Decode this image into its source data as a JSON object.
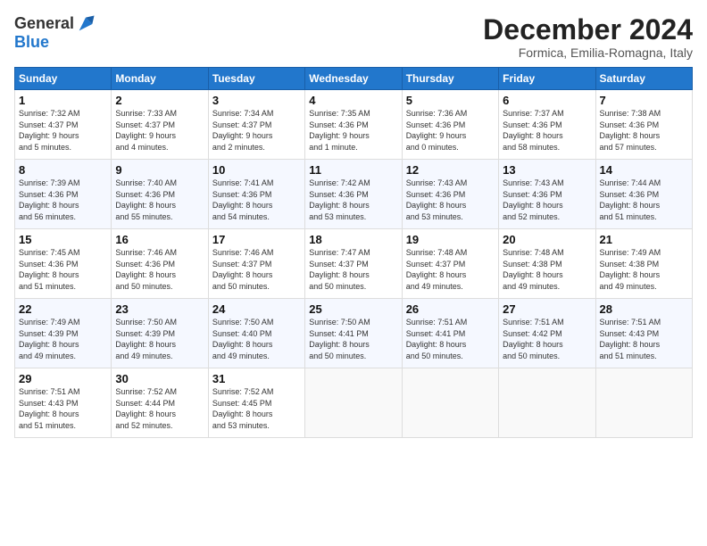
{
  "header": {
    "logo_line1": "General",
    "logo_line2": "Blue",
    "month": "December 2024",
    "location": "Formica, Emilia-Romagna, Italy"
  },
  "days_of_week": [
    "Sunday",
    "Monday",
    "Tuesday",
    "Wednesday",
    "Thursday",
    "Friday",
    "Saturday"
  ],
  "weeks": [
    [
      {
        "day": 1,
        "lines": [
          "Sunrise: 7:32 AM",
          "Sunset: 4:37 PM",
          "Daylight: 9 hours",
          "and 5 minutes."
        ]
      },
      {
        "day": 2,
        "lines": [
          "Sunrise: 7:33 AM",
          "Sunset: 4:37 PM",
          "Daylight: 9 hours",
          "and 4 minutes."
        ]
      },
      {
        "day": 3,
        "lines": [
          "Sunrise: 7:34 AM",
          "Sunset: 4:37 PM",
          "Daylight: 9 hours",
          "and 2 minutes."
        ]
      },
      {
        "day": 4,
        "lines": [
          "Sunrise: 7:35 AM",
          "Sunset: 4:36 PM",
          "Daylight: 9 hours",
          "and 1 minute."
        ]
      },
      {
        "day": 5,
        "lines": [
          "Sunrise: 7:36 AM",
          "Sunset: 4:36 PM",
          "Daylight: 9 hours",
          "and 0 minutes."
        ]
      },
      {
        "day": 6,
        "lines": [
          "Sunrise: 7:37 AM",
          "Sunset: 4:36 PM",
          "Daylight: 8 hours",
          "and 58 minutes."
        ]
      },
      {
        "day": 7,
        "lines": [
          "Sunrise: 7:38 AM",
          "Sunset: 4:36 PM",
          "Daylight: 8 hours",
          "and 57 minutes."
        ]
      }
    ],
    [
      {
        "day": 8,
        "lines": [
          "Sunrise: 7:39 AM",
          "Sunset: 4:36 PM",
          "Daylight: 8 hours",
          "and 56 minutes."
        ]
      },
      {
        "day": 9,
        "lines": [
          "Sunrise: 7:40 AM",
          "Sunset: 4:36 PM",
          "Daylight: 8 hours",
          "and 55 minutes."
        ]
      },
      {
        "day": 10,
        "lines": [
          "Sunrise: 7:41 AM",
          "Sunset: 4:36 PM",
          "Daylight: 8 hours",
          "and 54 minutes."
        ]
      },
      {
        "day": 11,
        "lines": [
          "Sunrise: 7:42 AM",
          "Sunset: 4:36 PM",
          "Daylight: 8 hours",
          "and 53 minutes."
        ]
      },
      {
        "day": 12,
        "lines": [
          "Sunrise: 7:43 AM",
          "Sunset: 4:36 PM",
          "Daylight: 8 hours",
          "and 53 minutes."
        ]
      },
      {
        "day": 13,
        "lines": [
          "Sunrise: 7:43 AM",
          "Sunset: 4:36 PM",
          "Daylight: 8 hours",
          "and 52 minutes."
        ]
      },
      {
        "day": 14,
        "lines": [
          "Sunrise: 7:44 AM",
          "Sunset: 4:36 PM",
          "Daylight: 8 hours",
          "and 51 minutes."
        ]
      }
    ],
    [
      {
        "day": 15,
        "lines": [
          "Sunrise: 7:45 AM",
          "Sunset: 4:36 PM",
          "Daylight: 8 hours",
          "and 51 minutes."
        ]
      },
      {
        "day": 16,
        "lines": [
          "Sunrise: 7:46 AM",
          "Sunset: 4:36 PM",
          "Daylight: 8 hours",
          "and 50 minutes."
        ]
      },
      {
        "day": 17,
        "lines": [
          "Sunrise: 7:46 AM",
          "Sunset: 4:37 PM",
          "Daylight: 8 hours",
          "and 50 minutes."
        ]
      },
      {
        "day": 18,
        "lines": [
          "Sunrise: 7:47 AM",
          "Sunset: 4:37 PM",
          "Daylight: 8 hours",
          "and 50 minutes."
        ]
      },
      {
        "day": 19,
        "lines": [
          "Sunrise: 7:48 AM",
          "Sunset: 4:37 PM",
          "Daylight: 8 hours",
          "and 49 minutes."
        ]
      },
      {
        "day": 20,
        "lines": [
          "Sunrise: 7:48 AM",
          "Sunset: 4:38 PM",
          "Daylight: 8 hours",
          "and 49 minutes."
        ]
      },
      {
        "day": 21,
        "lines": [
          "Sunrise: 7:49 AM",
          "Sunset: 4:38 PM",
          "Daylight: 8 hours",
          "and 49 minutes."
        ]
      }
    ],
    [
      {
        "day": 22,
        "lines": [
          "Sunrise: 7:49 AM",
          "Sunset: 4:39 PM",
          "Daylight: 8 hours",
          "and 49 minutes."
        ]
      },
      {
        "day": 23,
        "lines": [
          "Sunrise: 7:50 AM",
          "Sunset: 4:39 PM",
          "Daylight: 8 hours",
          "and 49 minutes."
        ]
      },
      {
        "day": 24,
        "lines": [
          "Sunrise: 7:50 AM",
          "Sunset: 4:40 PM",
          "Daylight: 8 hours",
          "and 49 minutes."
        ]
      },
      {
        "day": 25,
        "lines": [
          "Sunrise: 7:50 AM",
          "Sunset: 4:41 PM",
          "Daylight: 8 hours",
          "and 50 minutes."
        ]
      },
      {
        "day": 26,
        "lines": [
          "Sunrise: 7:51 AM",
          "Sunset: 4:41 PM",
          "Daylight: 8 hours",
          "and 50 minutes."
        ]
      },
      {
        "day": 27,
        "lines": [
          "Sunrise: 7:51 AM",
          "Sunset: 4:42 PM",
          "Daylight: 8 hours",
          "and 50 minutes."
        ]
      },
      {
        "day": 28,
        "lines": [
          "Sunrise: 7:51 AM",
          "Sunset: 4:43 PM",
          "Daylight: 8 hours",
          "and 51 minutes."
        ]
      }
    ],
    [
      {
        "day": 29,
        "lines": [
          "Sunrise: 7:51 AM",
          "Sunset: 4:43 PM",
          "Daylight: 8 hours",
          "and 51 minutes."
        ]
      },
      {
        "day": 30,
        "lines": [
          "Sunrise: 7:52 AM",
          "Sunset: 4:44 PM",
          "Daylight: 8 hours",
          "and 52 minutes."
        ]
      },
      {
        "day": 31,
        "lines": [
          "Sunrise: 7:52 AM",
          "Sunset: 4:45 PM",
          "Daylight: 8 hours",
          "and 53 minutes."
        ]
      },
      null,
      null,
      null,
      null
    ]
  ]
}
